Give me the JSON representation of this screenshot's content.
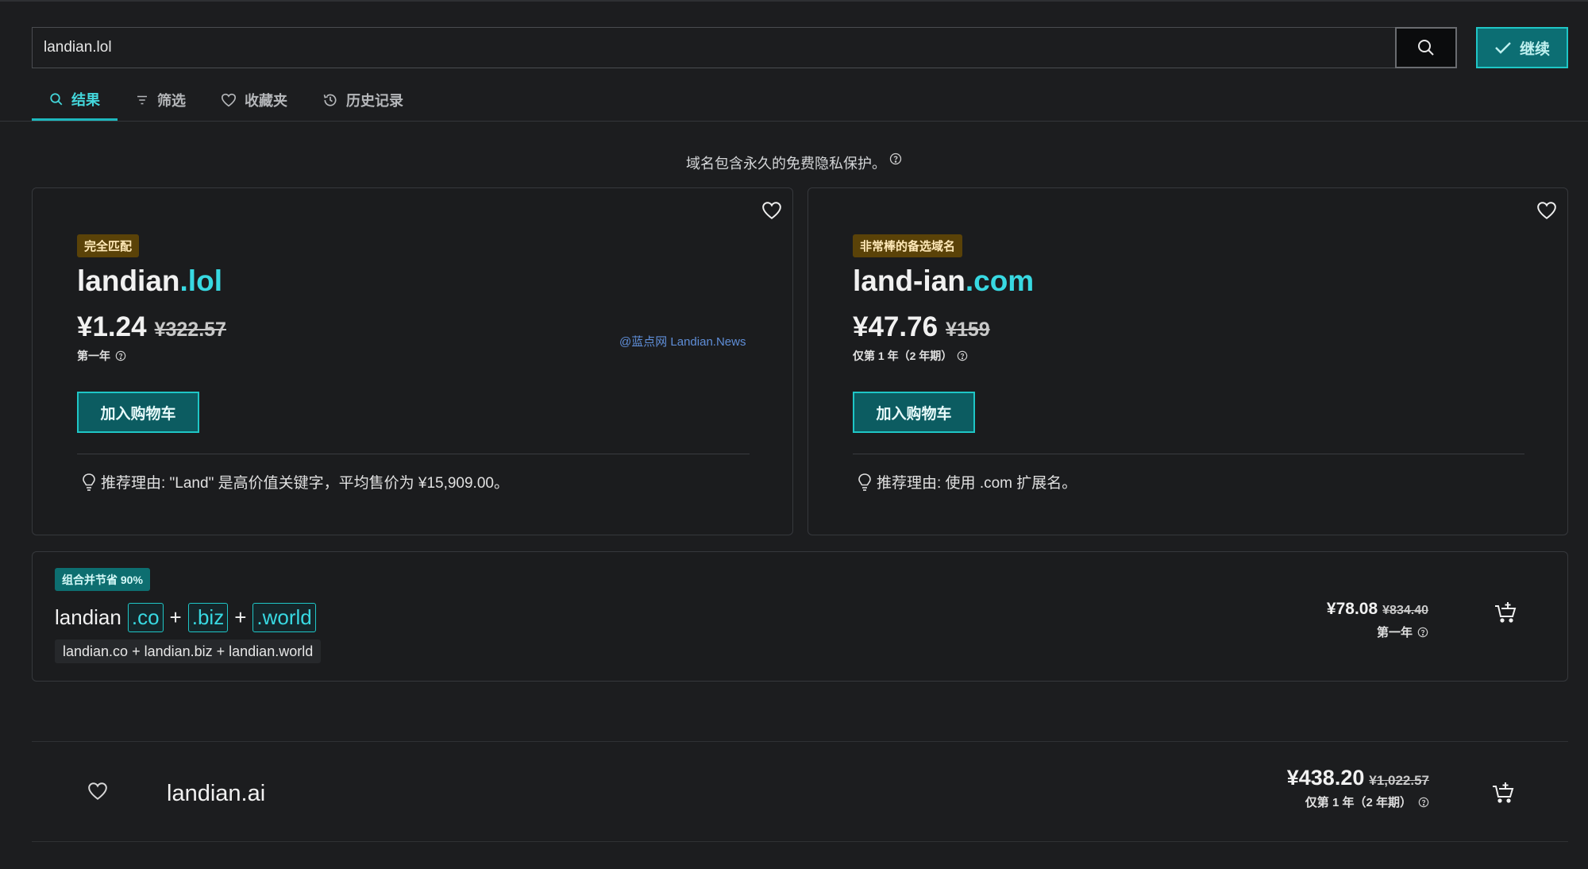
{
  "search": {
    "value": "landian.lol",
    "continue_label": "继续"
  },
  "tabs": [
    {
      "label": "结果",
      "icon": "search-icon",
      "active": true
    },
    {
      "label": "筛选",
      "icon": "filter-icon"
    },
    {
      "label": "收藏夹",
      "icon": "heart-icon"
    },
    {
      "label": "历史记录",
      "icon": "history-icon"
    }
  ],
  "notice": "域名包含永久的免费隐私保护。",
  "cards": [
    {
      "badge": "完全匹配",
      "name": "landian",
      "tld": ".lol",
      "price": "¥1.24",
      "old_price": "¥322.57",
      "price_note": "第一年",
      "watermark": "@蓝点网 Landian.News",
      "add_cart": "加入购物车",
      "reason": "推荐理由: \"Land\" 是高价值关键字，平均售价为 ¥15,909.00。"
    },
    {
      "badge": "非常棒的备选域名",
      "name": "land-ian",
      "tld": ".com",
      "price": "¥47.76",
      "old_price": "¥159",
      "price_note": "仅第 1 年（2 年期）",
      "add_cart": "加入购物车",
      "reason": "推荐理由: 使用 .com 扩展名。"
    }
  ],
  "bundle": {
    "badge": "组合并节省 90%",
    "name": "landian",
    "tlds": [
      ".co",
      ".biz",
      ".world"
    ],
    "plus": "+",
    "subtitle": "landian.co + landian.biz + landian.world",
    "price": "¥78.08",
    "old_price": "¥834.40",
    "price_note": "第一年"
  },
  "rows": [
    {
      "domain": "landian.ai",
      "price": "¥438.20",
      "old_price": "¥1,022.57",
      "price_note": "仅第 1 年（2 年期）"
    }
  ],
  "colors": {
    "accent": "#1fc6c6",
    "tld": "#38d9e2",
    "badge_gold": "#5a4208",
    "badge_teal": "#0d6e70",
    "background": "#1c1d1f"
  }
}
